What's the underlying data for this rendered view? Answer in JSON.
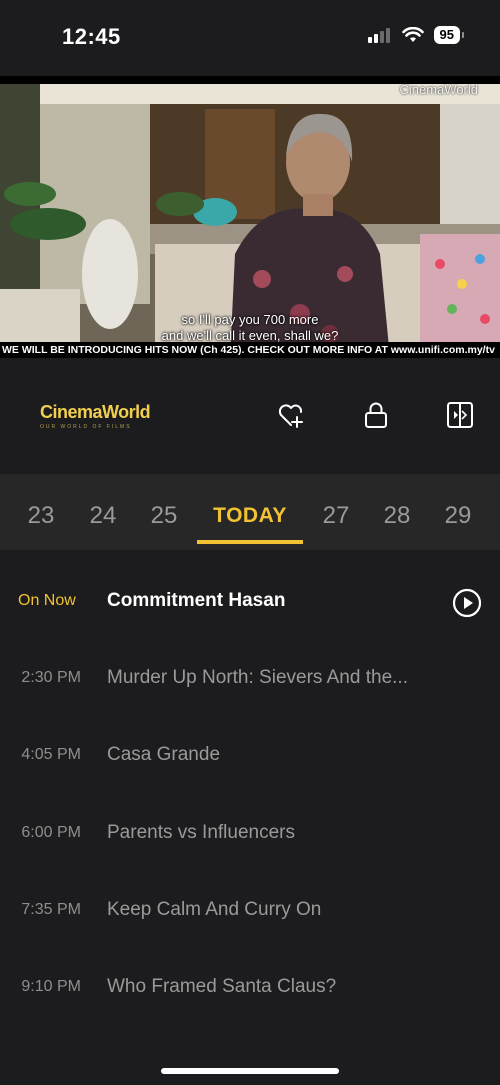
{
  "status_bar": {
    "time": "12:45",
    "battery": "95"
  },
  "video": {
    "watermark": "CinemaWorld",
    "subtitle_line1": "so I'll pay you 700 more",
    "subtitle_line2": "and we'll call it even, shall we?",
    "ticker": "WE WILL BE INTRODUCING HITS NOW (Ch 425). CHECK OUT MORE INFO AT www.unifi.com.my/tv"
  },
  "channel": {
    "logo_name": "CinemaWorld",
    "logo_tagline": "OUR WORLD OF FILMS",
    "icons": [
      "heart-plus-icon",
      "lock-icon",
      "picture-in-picture-icon"
    ]
  },
  "dates": [
    "23",
    "24",
    "25",
    "TODAY",
    "27",
    "28",
    "29"
  ],
  "active_date": "TODAY",
  "schedule": [
    {
      "time": "On Now",
      "title": "Commitment Hasan"
    },
    {
      "time": "2:30 PM",
      "title": "Murder Up North: Sievers And the..."
    },
    {
      "time": "4:05 PM",
      "title": "Casa Grande"
    },
    {
      "time": "6:00 PM",
      "title": "Parents vs Influencers"
    },
    {
      "time": "7:35 PM",
      "title": "Keep Calm And Curry On"
    },
    {
      "time": "9:10 PM",
      "title": "Who Framed Santa Claus?"
    }
  ],
  "colors": {
    "accent": "#f1c231",
    "background": "#1c1c1e",
    "date_bar": "#272727"
  }
}
